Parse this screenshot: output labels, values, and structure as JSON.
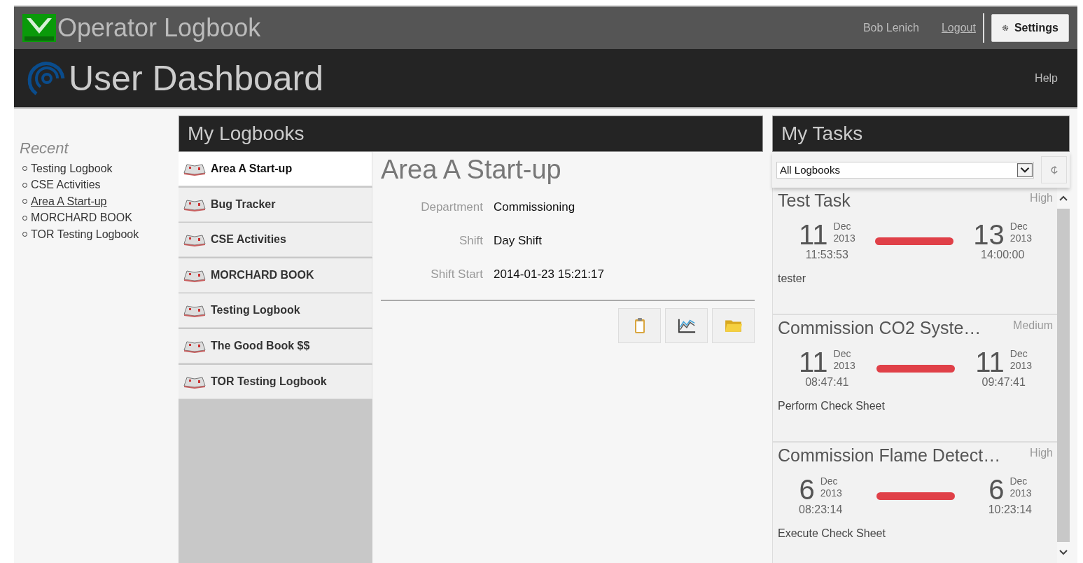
{
  "app": {
    "title": "Operator Logbook",
    "user": "Bob Lenich",
    "logout": "Logout",
    "settings": "Settings"
  },
  "page": {
    "title": "User Dashboard",
    "help": "Help"
  },
  "recent": {
    "title": "Recent",
    "items": [
      {
        "label": "Testing Logbook",
        "selected": false
      },
      {
        "label": "CSE Activities",
        "selected": false
      },
      {
        "label": "Area A Start-up",
        "selected": true
      },
      {
        "label": "MORCHARD BOOK",
        "selected": false
      },
      {
        "label": "TOR Testing Logbook",
        "selected": false
      }
    ]
  },
  "logbooks": {
    "title": "My Logbooks",
    "items": [
      {
        "label": "Area A Start-up",
        "selected": true
      },
      {
        "label": "Bug Tracker",
        "selected": false
      },
      {
        "label": "CSE Activities",
        "selected": false
      },
      {
        "label": "MORCHARD BOOK",
        "selected": false
      },
      {
        "label": "Testing Logbook",
        "selected": false
      },
      {
        "label": "The Good Book $$",
        "selected": false
      },
      {
        "label": "TOR Testing Logbook",
        "selected": false
      }
    ],
    "detail": {
      "title": "Area A Start-up",
      "fields": [
        {
          "label": "Department",
          "value": "Commissioning"
        },
        {
          "label": "Shift",
          "value": "Day Shift"
        },
        {
          "label": "Shift Start",
          "value": "2014-01-23 15:21:17"
        }
      ],
      "actions": [
        {
          "kind": "clipboard"
        },
        {
          "kind": "chart"
        },
        {
          "kind": "folder"
        }
      ]
    }
  },
  "tasks": {
    "title": "My Tasks",
    "filter": "All Logbooks",
    "items": [
      {
        "title": "Test Task",
        "priority": "High",
        "start": {
          "day": "11",
          "month": "Dec",
          "year": "2013",
          "time": "11:53:53"
        },
        "end": {
          "day": "13",
          "month": "Dec",
          "year": "2013",
          "time": "14:00:00"
        },
        "description": "tester"
      },
      {
        "title": "Commission CO2 Syste…",
        "priority": "Medium",
        "start": {
          "day": "11",
          "month": "Dec",
          "year": "2013",
          "time": "08:47:41"
        },
        "end": {
          "day": "11",
          "month": "Dec",
          "year": "2013",
          "time": "09:47:41"
        },
        "description": "Perform Check Sheet"
      },
      {
        "title": "Commission Flame Detect…",
        "priority": "High",
        "start": {
          "day": "6",
          "month": "Dec",
          "year": "2013",
          "time": "08:23:14"
        },
        "end": {
          "day": "6",
          "month": "Dec",
          "year": "2013",
          "time": "10:23:14"
        },
        "description": "Execute Check Sheet"
      }
    ]
  }
}
